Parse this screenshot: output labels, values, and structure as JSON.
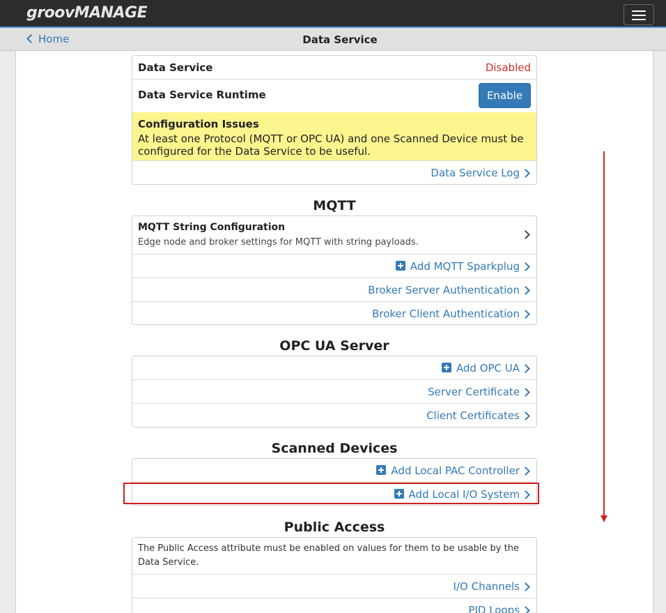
{
  "brand": {
    "part1": "groov",
    "part2": "MANAGE"
  },
  "header": {
    "back_label": "Home",
    "title": "Data Service"
  },
  "data_service": {
    "status_label": "Data Service",
    "status_value": "Disabled",
    "runtime_label": "Data Service Runtime",
    "enable_button": "Enable",
    "issues_title": "Configuration Issues",
    "issues_text": "At least one Protocol (MQTT or OPC UA) and one Scanned Device must be configured for the Data Service to be useful.",
    "log_link": "Data Service Log"
  },
  "mqtt": {
    "section_title": "MQTT",
    "string_config_title": "MQTT String Configuration",
    "string_config_desc": "Edge node and broker settings for MQTT with string payloads.",
    "add_sparkplug": "Add MQTT Sparkplug",
    "broker_server_auth": "Broker Server Authentication",
    "broker_client_auth": "Broker Client Authentication"
  },
  "opcua": {
    "section_title": "OPC UA Server",
    "add_opcua": "Add OPC UA",
    "server_cert": "Server Certificate",
    "client_certs": "Client Certificates"
  },
  "scanned": {
    "section_title": "Scanned Devices",
    "add_pac": "Add Local PAC Controller",
    "add_io": "Add Local I/O System"
  },
  "public_access": {
    "section_title": "Public Access",
    "description": "The Public Access attribute must be enabled on values for them to be usable by the Data Service.",
    "io_channels": "I/O Channels",
    "pid_loops": "PID Loops"
  },
  "colors": {
    "link": "#337ab7",
    "disabled": "#c9302c",
    "warning_bg": "#fbf58e",
    "annotation": "#d11e1e"
  },
  "icons": {
    "menu": "hamburger-icon",
    "back": "chevron-left-icon",
    "forward": "chevron-right-icon",
    "add": "plus-square-icon"
  }
}
